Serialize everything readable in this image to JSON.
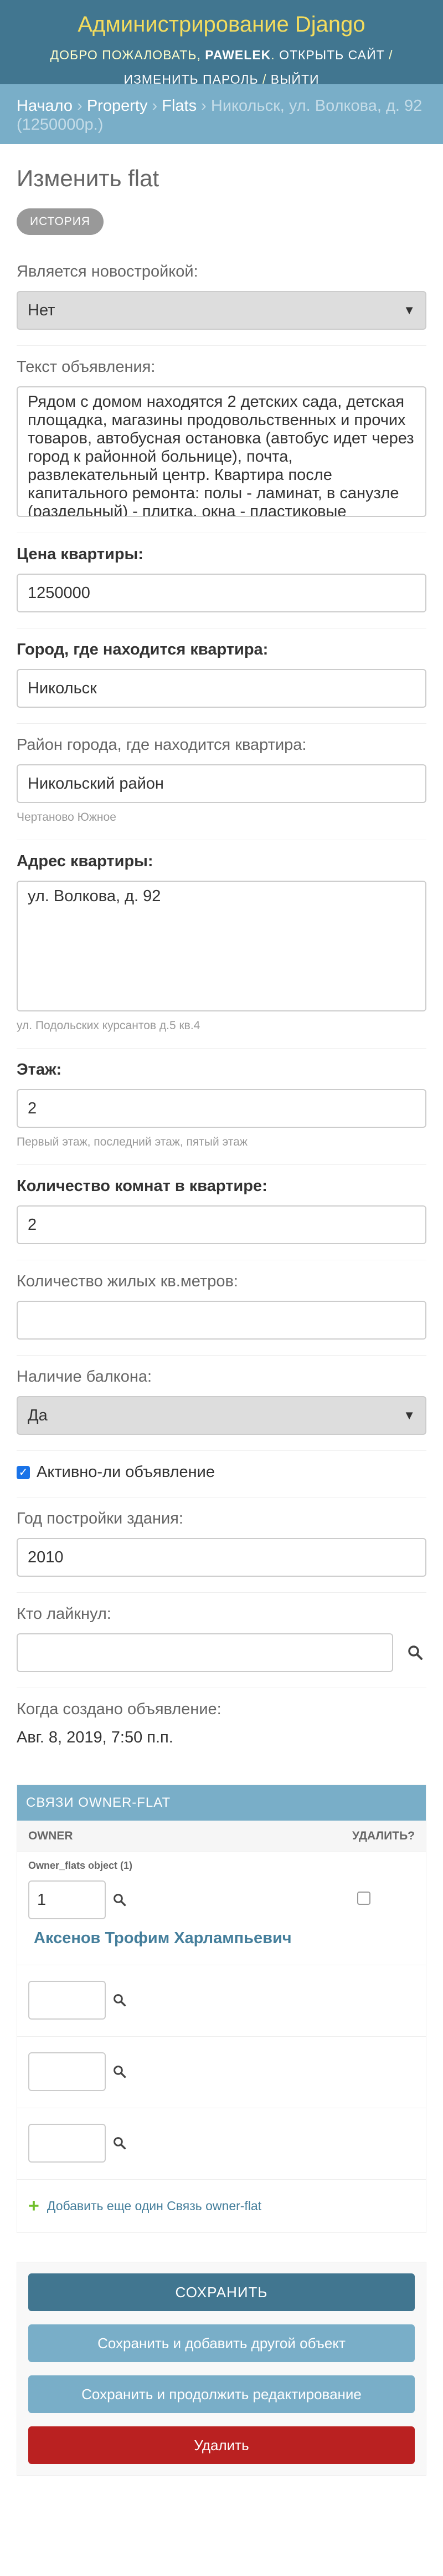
{
  "header": {
    "site_name": "Администрирование Django",
    "welcome": "Добро пожаловать,",
    "username": "PAWELEK",
    "view_site": "Открыть сайт",
    "change_password": "Изменить пароль",
    "logout": "Выйти",
    "separator": "/"
  },
  "breadcrumbs": {
    "home": "Начало",
    "app": "Property",
    "model": "Flats",
    "current": "Никольск, ул. Волкова, д. 92 (1250000р.)",
    "sep": "›"
  },
  "page": {
    "title": "Изменить flat",
    "history": "История"
  },
  "fields": {
    "new_building": {
      "label": "Является новостройкой:",
      "value": "Нет"
    },
    "description": {
      "label": "Текст объявления:",
      "value": "Рядом с домом находятся 2 детских сада, детская площадка, магазины продовольственных и прочих товаров, автобусная остановка (автобус идет через город к районной больнице), почта, развлекательный центр. Квартира после капитального ремонта: полы - ламинат, в санузле (раздельный) - плитка, окна - пластиковые"
    },
    "price": {
      "label": "Цена квартиры:",
      "value": "1250000"
    },
    "town": {
      "label": "Город, где находится квартира:",
      "value": "Никольск"
    },
    "district": {
      "label": "Район города, где находится квартира:",
      "value": "Никольский район",
      "help": "Чертаново Южное"
    },
    "address": {
      "label": "Адрес квартиры:",
      "value": "ул. Волкова, д. 92",
      "help": "ул. Подольских курсантов д.5 кв.4"
    },
    "floor": {
      "label": "Этаж:",
      "value": "2",
      "help": "Первый этаж, последний этаж, пятый этаж"
    },
    "rooms": {
      "label": "Количество комнат в квартире:",
      "value": "2"
    },
    "living_area": {
      "label": "Количество жилых кв.метров:",
      "value": ""
    },
    "balcony": {
      "label": "Наличие балкона:",
      "value": "Да"
    },
    "active": {
      "label": "Активно-ли объявление",
      "checked": true
    },
    "construction_year": {
      "label": "Год постройки здания:",
      "value": "2010"
    },
    "liked_by": {
      "label": "Кто лайкнул:",
      "value": ""
    },
    "created_at": {
      "label": "Когда создано объявление:",
      "value": "Авг. 8, 2019, 7:50 п.п."
    }
  },
  "inline": {
    "title": "Связи owner-flat",
    "col_owner": "Owner",
    "col_delete": "Удалить?",
    "object_label": "Owner_flats object (1)",
    "row1_value": "1",
    "row1_link": "Аксенов Трофим Харлампьевич",
    "add_another": "Добавить еще один Связь owner-flat"
  },
  "submit": {
    "save": "Сохранить",
    "save_add": "Сохранить и добавить другой объект",
    "save_continue": "Сохранить и продолжить редактирование",
    "delete": "Удалить"
  },
  "colors": {
    "header_bg": "#417690",
    "breadcrumbs_bg": "#79aec8",
    "site_name": "#f5dd5d",
    "delete_bg": "#ba2121",
    "link": "#447e9b"
  }
}
